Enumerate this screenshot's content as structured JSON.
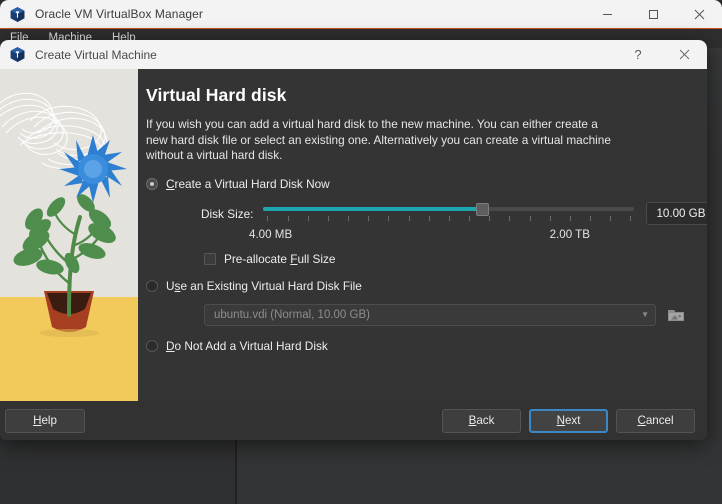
{
  "main_window": {
    "title": "Oracle VM VirtualBox Manager",
    "logo_icon": "virtualbox-cube-icon",
    "controls": [
      {
        "name": "minimize",
        "glyph": "minimize-icon"
      },
      {
        "name": "maximize",
        "glyph": "maximize-icon"
      },
      {
        "name": "close",
        "glyph": "close-icon"
      }
    ],
    "menu": [
      "File",
      "Machine",
      "Help"
    ]
  },
  "dialog": {
    "title": "Create Virtual Machine",
    "logo_icon": "virtualbox-cube-icon",
    "help_button": "?",
    "close_button": "✕",
    "page_title": "Virtual Hard disk",
    "page_description": "If you wish you can add a virtual hard disk to the new machine. You can either create a new hard disk file or select an existing one. Alternatively you can create a virtual machine without a virtual hard disk.",
    "options": {
      "create_now": {
        "label": "Create a Virtual Hard Disk Now",
        "mnemonic": "C",
        "selected": true
      },
      "use_existing": {
        "label": "Use an Existing Virtual Hard Disk File",
        "mnemonic": "s",
        "selected": false
      },
      "do_not_add": {
        "label": "Do Not Add a Virtual Hard Disk",
        "mnemonic": "D",
        "selected": false
      }
    },
    "disk_size": {
      "label": "Disk Size:",
      "value": "10.00 GB",
      "min_label": "4.00 MB",
      "max_label": "2.00 TB",
      "fill_percent": 59,
      "tick_count": 19,
      "accent_color": "#1ea6b0"
    },
    "preallocate": {
      "label": "Pre-allocate Full Size",
      "mnemonic": "F",
      "checked": false
    },
    "existing_file": {
      "value": "ubuntu.vdi (Normal, 10.00 GB)",
      "caret_icon": "chevron-down-icon",
      "browse_icon": "folder-disk-browse-icon",
      "disabled": true
    },
    "buttons": {
      "help": {
        "label": "Help",
        "mnemonic": "H"
      },
      "back": {
        "label": "Back",
        "mnemonic": "B"
      },
      "next": {
        "label": "Next",
        "mnemonic": "N",
        "focused": true
      },
      "cancel": {
        "label": "Cancel",
        "mnemonic": "C"
      }
    }
  }
}
